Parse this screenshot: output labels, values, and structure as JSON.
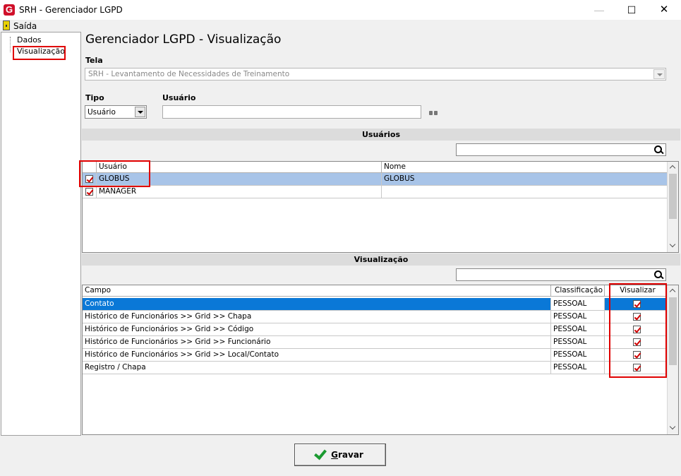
{
  "window": {
    "title": "SRH - Gerenciador LGPD",
    "minimize": "—",
    "maximize": "☐",
    "close": "✕"
  },
  "menu": {
    "exit_label": "Saída"
  },
  "tree": {
    "items": [
      {
        "label": "Dados"
      },
      {
        "label": "Visualização"
      }
    ]
  },
  "page": {
    "title": "Gerenciador LGPD - Visualização"
  },
  "form": {
    "tela_label": "Tela",
    "tela_value": "SRH - Levantamento de Necessidades de Treinamento",
    "tipo_label": "Tipo",
    "tipo_value": "Usuário",
    "usuario_label": "Usuário",
    "usuario_value": ""
  },
  "users_section": {
    "title": "Usuários",
    "columns": {
      "usuario": "Usuário",
      "nome": "Nome"
    },
    "rows": [
      {
        "usuario": "GLOBUS",
        "nome": "GLOBUS",
        "checked": true,
        "selected": true
      },
      {
        "usuario": "MANAGER",
        "nome": "",
        "checked": true,
        "selected": false
      }
    ]
  },
  "vis_section": {
    "title": "Visualização",
    "columns": {
      "campo": "Campo",
      "classificacao": "Classificação",
      "visualizar": "Visualizar"
    },
    "rows": [
      {
        "campo": "Contato",
        "classificacao": "PESSOAL",
        "visualizar": true,
        "selected": true
      },
      {
        "campo": "Histórico de Funcionários >> Grid >> Chapa",
        "classificacao": "PESSOAL",
        "visualizar": true
      },
      {
        "campo": "Histórico de Funcionários >> Grid >> Código",
        "classificacao": "PESSOAL",
        "visualizar": true
      },
      {
        "campo": "Histórico de Funcionários >> Grid >> Funcionário",
        "classificacao": "PESSOAL",
        "visualizar": true
      },
      {
        "campo": "Histórico de Funcionários >> Grid >> Local/Contato",
        "classificacao": "PESSOAL",
        "visualizar": true
      },
      {
        "campo": "Registro / Chapa",
        "classificacao": "PESSOAL",
        "visualizar": true
      }
    ]
  },
  "footer": {
    "save_label_first": "G",
    "save_label_rest": "ravar"
  },
  "colors": {
    "highlight": "#e00000",
    "selection_blue": "#0a78d7",
    "selection_light": "#a8c4e8",
    "checkmark": "#1a9a30"
  }
}
